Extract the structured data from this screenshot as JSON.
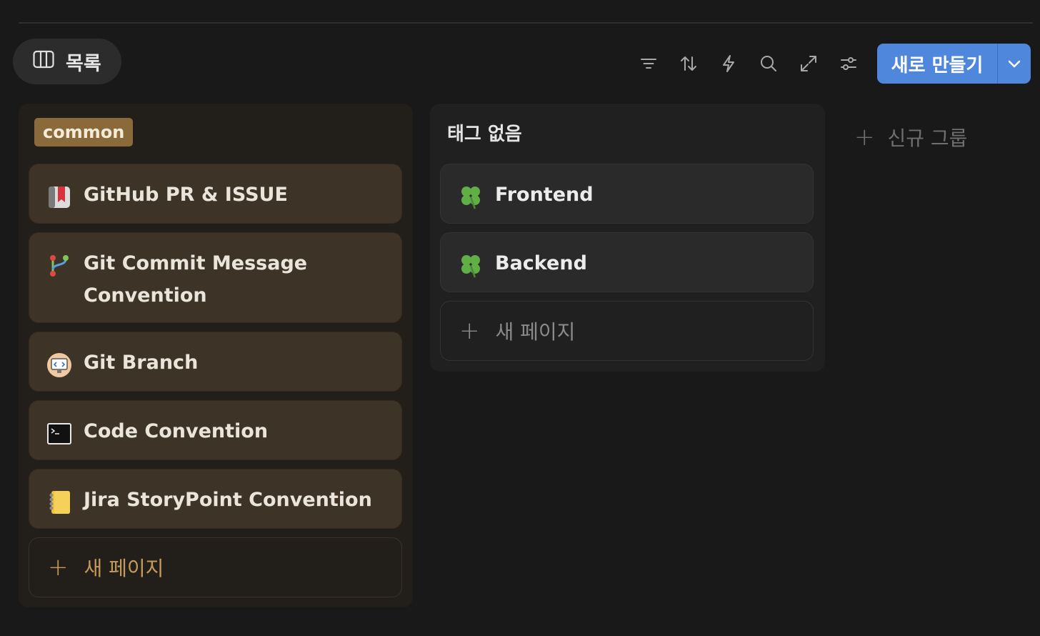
{
  "view_tab": {
    "label": "목록",
    "icon": "columns-icon"
  },
  "toolbar": {
    "icons": [
      "filter-icon",
      "sort-icon",
      "automation-icon",
      "search-icon",
      "expand-icon",
      "settings-icon"
    ],
    "new_button_label": "새로 만들기"
  },
  "groups": [
    {
      "tag": "common",
      "tag_color": "#8a6a3a",
      "cards": [
        {
          "icon": "bookmark-icon",
          "title": "GitHub PR & ISSUE"
        },
        {
          "icon": "git-branch-icon",
          "title": "Git Commit Message Convention"
        },
        {
          "icon": "computer-code-icon",
          "title": "Git Branch"
        },
        {
          "icon": "terminal-icon",
          "title": "Code Convention"
        },
        {
          "icon": "notebook-icon",
          "title": "Jira StoryPoint Convention"
        }
      ],
      "add_label": "새 페이지"
    },
    {
      "title": "태그 없음",
      "cards": [
        {
          "icon": "four-leaf-clover-icon",
          "title": "Frontend"
        },
        {
          "icon": "four-leaf-clover-icon",
          "title": "Backend"
        }
      ],
      "add_label": "새 페이지"
    }
  ],
  "new_group_label": "신규 그룹",
  "colors": {
    "accent": "#4f87dd",
    "tag_common": "#8a6a3a",
    "add_common": "#c59b5b"
  }
}
